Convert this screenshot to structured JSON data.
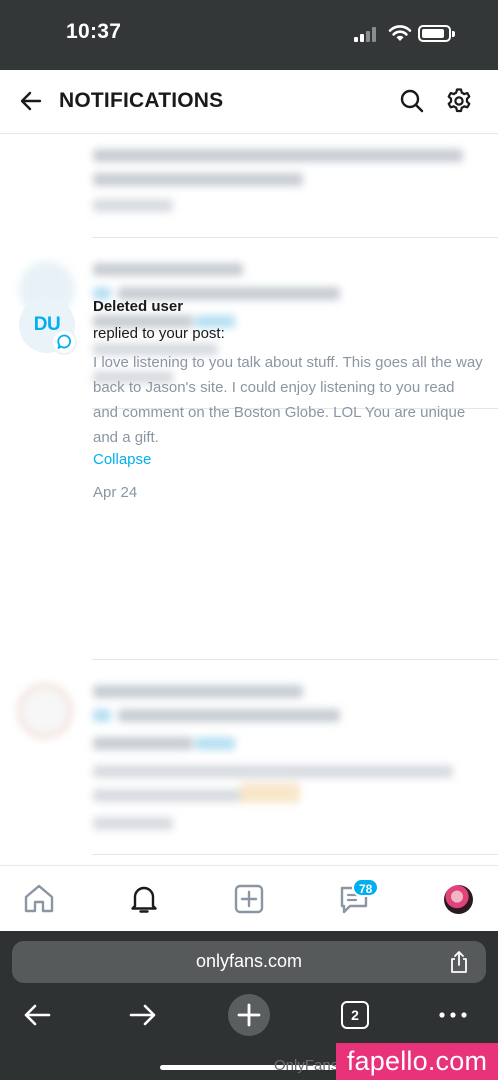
{
  "status_bar": {
    "time": "10:37",
    "signal_icon": "cellular-signal-icon",
    "wifi_icon": "wifi-icon",
    "battery_icon": "battery-icon"
  },
  "header": {
    "title": "NOTIFICATIONS",
    "back_icon": "back-arrow-icon",
    "search_icon": "search-icon",
    "settings_icon": "gear-icon"
  },
  "notification": {
    "avatar_initials": "DU",
    "badge_icon": "comment-bubble-icon",
    "user_name": "Deleted user",
    "action": "replied to your post:",
    "comment": "I love listening to you talk about stuff. This goes all the way back to Jason's site. I could enjoy listening to you read and comment on the Boston Globe. LOL You are unique and a gift.",
    "collapse_label": "Collapse",
    "date": "Apr 24"
  },
  "bottom_nav": {
    "items": [
      "home-icon",
      "bell-icon",
      "add-post-icon",
      "messages-icon",
      "profile-avatar"
    ],
    "messages_badge": "78"
  },
  "browser": {
    "url": "onlyfans.com",
    "tab_count": "2",
    "watermark_faded": "OnlyFans",
    "watermark": "fapello.com"
  },
  "colors": {
    "accent": "#00aff0",
    "status_bar_bg": "#343737",
    "browser_bg": "#2f3232",
    "muted_text": "#8a96a3",
    "watermark_bg": "#e8327a"
  }
}
